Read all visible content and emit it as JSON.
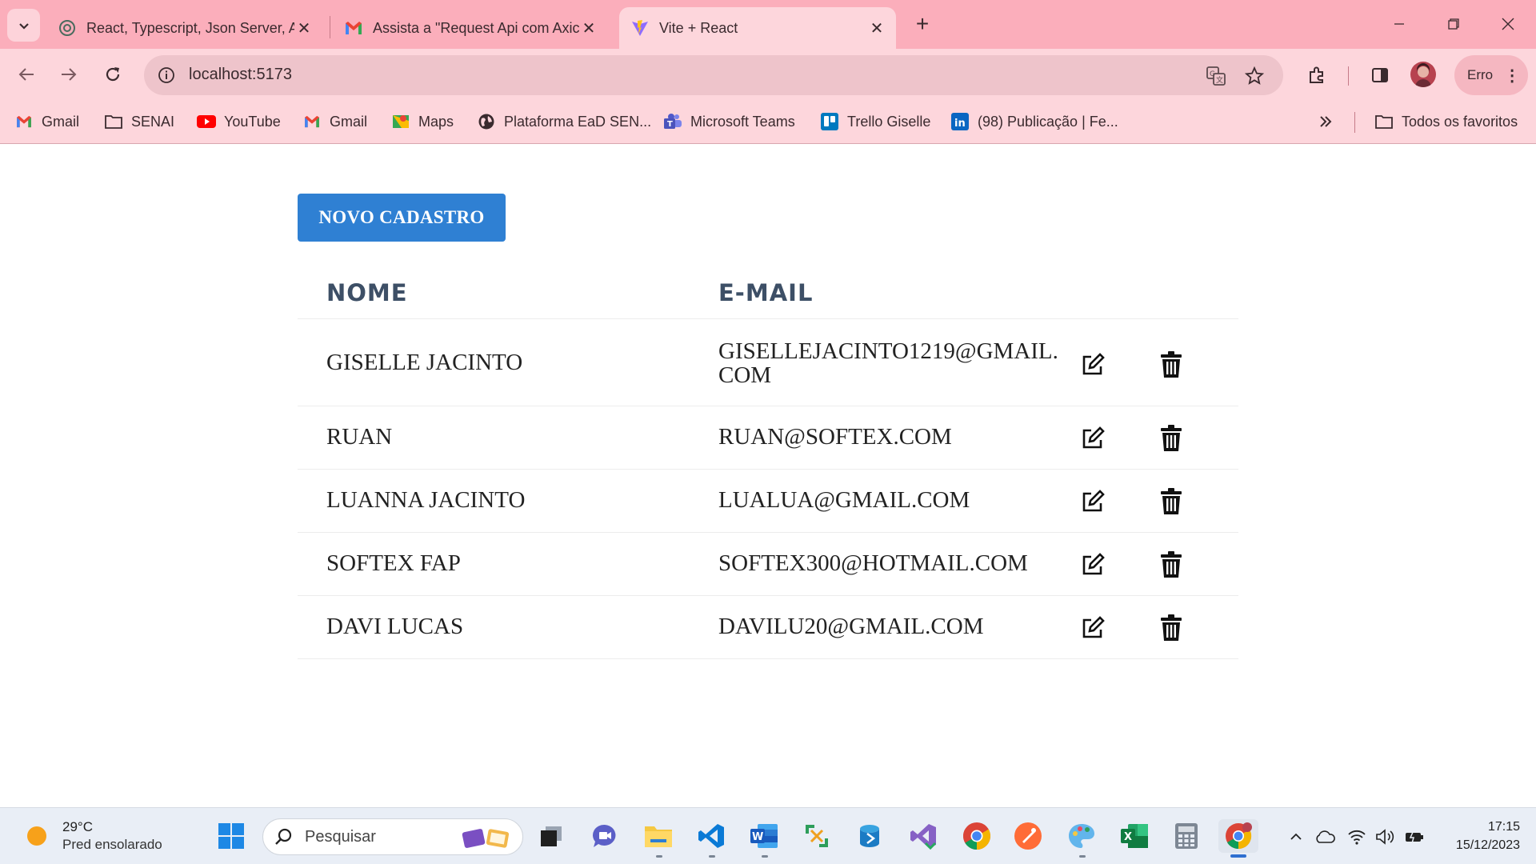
{
  "browser": {
    "tabs": [
      {
        "title": "React, Typescript, Json Server, A",
        "favicon": "chatgpt-icon"
      },
      {
        "title": "Assista a \"Request Api com Axic",
        "favicon": "gmail-icon"
      },
      {
        "title": "Vite + React",
        "favicon": "vite-icon",
        "active": true
      }
    ],
    "address": "localhost:5173",
    "profile_label": "Erro",
    "bookmarks": [
      {
        "label": "Gmail",
        "icon": "gmail-icon"
      },
      {
        "label": "SENAI",
        "icon": "folder-icon"
      },
      {
        "label": "YouTube",
        "icon": "youtube-icon"
      },
      {
        "label": "Gmail",
        "icon": "gmail-icon"
      },
      {
        "label": "Maps",
        "icon": "maps-icon"
      },
      {
        "label": "Plataforma EaD SEN...",
        "icon": "globe-icon"
      },
      {
        "label": "Microsoft Teams",
        "icon": "teams-icon"
      },
      {
        "label": "Trello Giselle",
        "icon": "trello-icon"
      },
      {
        "label": "(98) Publicação | Fe...",
        "icon": "linkedin-icon"
      }
    ],
    "all_bookmarks_label": "Todos os favoritos"
  },
  "page": {
    "new_button_label": "NOVO CADASTRO",
    "columns": {
      "name": "NOME",
      "email": "E-MAIL"
    },
    "rows": [
      {
        "name": "GISELLE JACINTO",
        "email": "GISELLEJACINTO1219@GMAIL.COM"
      },
      {
        "name": "RUAN",
        "email": "RUAN@SOFTEX.COM"
      },
      {
        "name": "LUANNA JACINTO",
        "email": "LUALUA@GMAIL.COM"
      },
      {
        "name": "SOFTEX FAP",
        "email": "SOFTEX300@HOTMAIL.COM"
      },
      {
        "name": "DAVI LUCAS",
        "email": "DAVILU20@GMAIL.COM"
      }
    ]
  },
  "taskbar": {
    "weather_temp": "29°C",
    "weather_condition": "Pred ensolarado",
    "search_placeholder": "Pesquisar",
    "time": "17:15",
    "date": "15/12/2023"
  },
  "colors": {
    "tab_strip": "#fbaebb",
    "toolbar": "#fdd6dc",
    "primary_button": "#2f80d3",
    "header_text": "#3d4f66"
  }
}
